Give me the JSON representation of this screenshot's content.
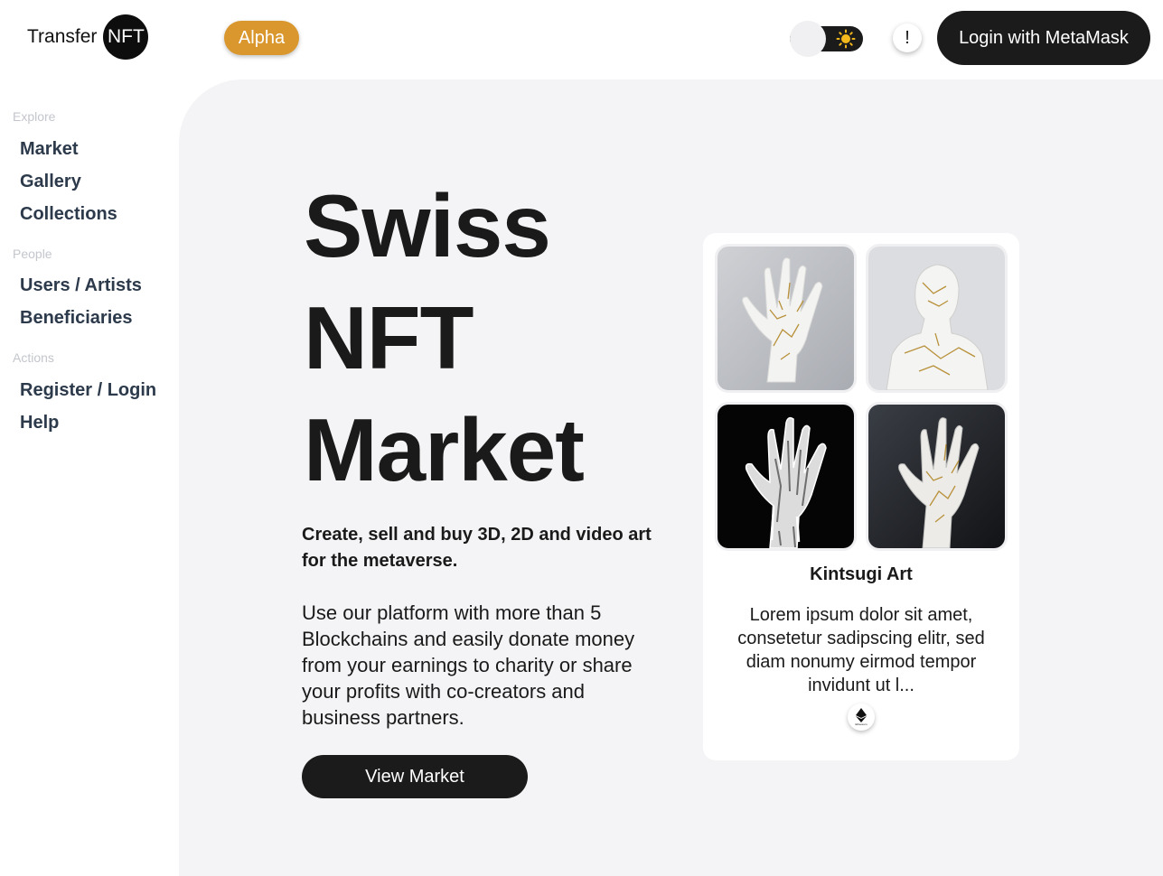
{
  "header": {
    "logo_text": "Transfer",
    "logo_badge": "NFT",
    "alpha_badge": "Alpha",
    "info_label": "!",
    "login_label": "Login with MetaMask"
  },
  "theme_toggle": {
    "icon": "sun-icon",
    "mode": "light"
  },
  "sidebar": {
    "sections": [
      {
        "title": "Explore",
        "items": [
          "Market",
          "Gallery",
          "Collections"
        ]
      },
      {
        "title": "People",
        "items": [
          "Users / Artists",
          "Beneficiaries"
        ]
      },
      {
        "title": "Actions",
        "items": [
          "Register / Login",
          "Help"
        ]
      }
    ]
  },
  "hero": {
    "title_lines": [
      "Swiss",
      "NFT",
      "Market"
    ],
    "subtitle": "Create, sell and buy 3D, 2D and video art for the metaverse.",
    "description": "Use our platform with more than 5 Blockchains and easily donate money from your earnings to charity or share your profits with co-creators and business partners.",
    "cta_label": "View Market"
  },
  "card": {
    "images": [
      "white-kintsugi-hand",
      "white-kintsugi-bust",
      "chrome-melting-hand",
      "white-hand-dark-background"
    ],
    "title": "Kintsugi Art",
    "description": "Lorem ipsum dolor sit amet, consetetur sadipscing elitr, sed diam nonumy eirmod tempor invidunt ut l...",
    "chain_icon": "ethereum-icon",
    "chain_label": "Ethereum"
  },
  "colors": {
    "accent": "#d9972e",
    "dark": "#1b1b1b",
    "main_bg": "#f4f4f6",
    "nav_text": "#2c3a4b",
    "section_text": "#c3c6cc"
  }
}
